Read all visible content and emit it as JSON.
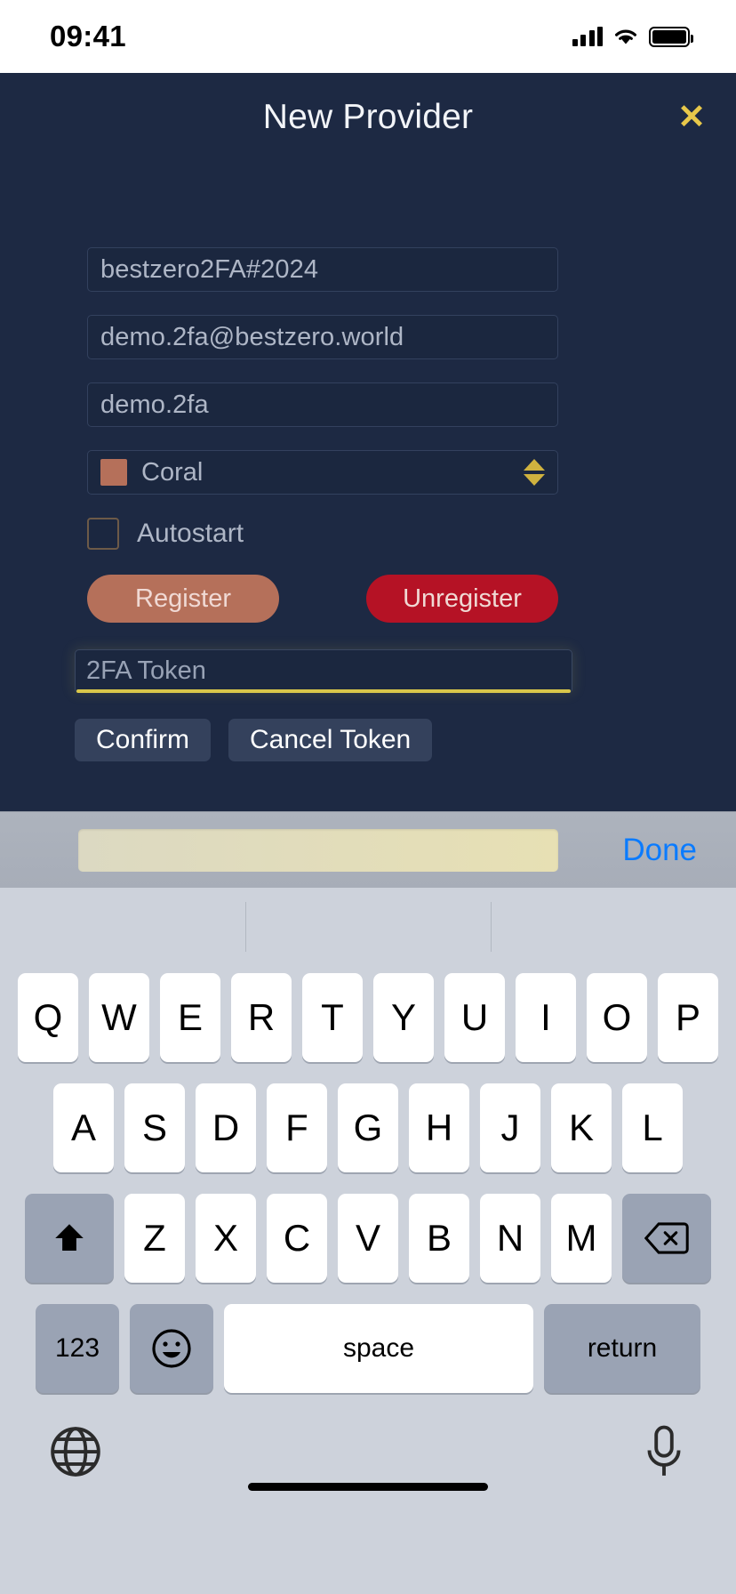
{
  "status_bar": {
    "time": "09:41",
    "signal_icon": "cellular-signal-icon",
    "wifi_icon": "wifi-icon",
    "battery_icon": "battery-full-icon"
  },
  "dialog": {
    "title": "New Provider",
    "close_label": "✕",
    "background_color": "#1d2943",
    "accent_color": "#e8c84a"
  },
  "form": {
    "fields": [
      {
        "name": "password-field",
        "value": "bestzero2FA#2024"
      },
      {
        "name": "email-field",
        "value": "demo.2fa@bestzero.world"
      },
      {
        "name": "username-field",
        "value": "demo.2fa"
      }
    ],
    "color_select": {
      "label": "Coral",
      "swatch_color": "#b5705a",
      "stepper_color": "#cfb23f"
    },
    "checkbox": {
      "label": "Autostart",
      "checked": false
    },
    "register_button": {
      "label": "Register",
      "color": "#b5705a"
    },
    "unregister_button": {
      "label": "Unregister",
      "color": "#b51225"
    },
    "token_input": {
      "placeholder": "2FA Token",
      "value": "",
      "focus_underline_color": "#d9c74a"
    },
    "confirm_button": {
      "label": "Confirm"
    },
    "cancel_token_button": {
      "label": "Cancel Token"
    }
  },
  "accessory_bar": {
    "done_label": "Done",
    "done_color": "#0a7bff"
  },
  "keyboard": {
    "row1": [
      "Q",
      "W",
      "E",
      "R",
      "T",
      "Y",
      "U",
      "I",
      "O",
      "P"
    ],
    "row2": [
      "A",
      "S",
      "D",
      "F",
      "G",
      "H",
      "J",
      "K",
      "L"
    ],
    "row3": [
      "Z",
      "X",
      "C",
      "V",
      "B",
      "N",
      "M"
    ],
    "shift_icon": "⬆",
    "backspace_icon": "⌫",
    "numbers_label": "123",
    "emoji_icon": "☺",
    "space_label": "space",
    "return_label": "return",
    "globe_icon": "globe-icon",
    "mic_icon": "microphone-icon"
  }
}
